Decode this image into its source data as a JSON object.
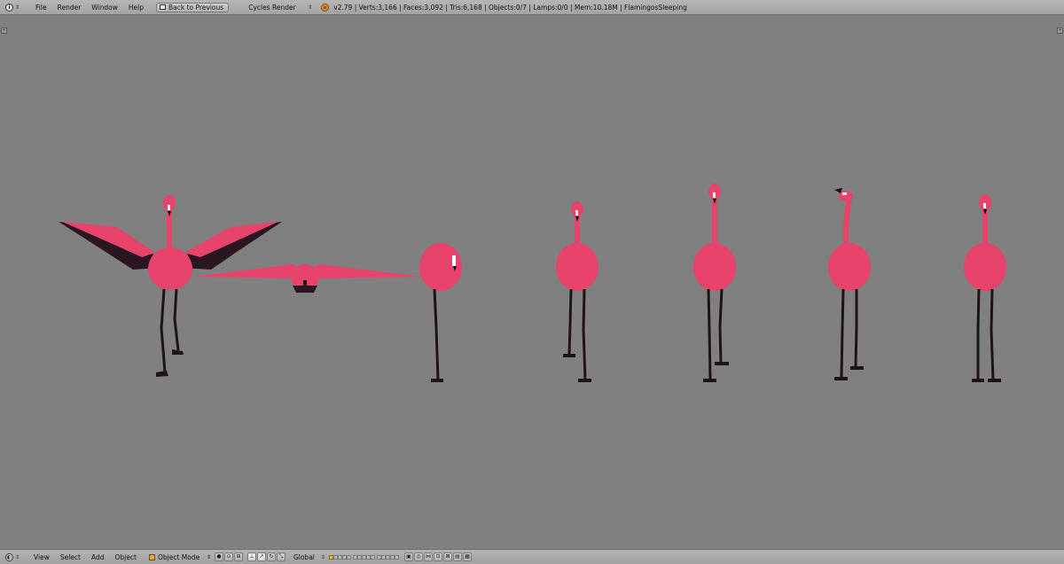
{
  "top_header": {
    "menus": [
      "File",
      "Render",
      "Window",
      "Help"
    ],
    "back_button_label": "Back to Previous",
    "render_engine": "Cycles Render",
    "stats": "v2.79 | Verts:3,166 | Faces:3,092 | Tris:6,168 | Objects:0/7 | Lamps:0/0 | Mem:10.18M | FlamingosSleeping"
  },
  "bottom_header": {
    "menus": [
      "View",
      "Select",
      "Add",
      "Object"
    ],
    "mode": "Object Mode",
    "orientation": "Global"
  },
  "scene": {
    "background_color": "#808080",
    "flamingo_pink": "#e8436a",
    "flamingo_shadow": "#2a1620",
    "flamingos": [
      {
        "pose": "wings-spread"
      },
      {
        "pose": "flying"
      },
      {
        "pose": "sleeping"
      },
      {
        "pose": "standing"
      },
      {
        "pose": "standing"
      },
      {
        "pose": "standing-head-turned"
      },
      {
        "pose": "standing"
      }
    ]
  }
}
